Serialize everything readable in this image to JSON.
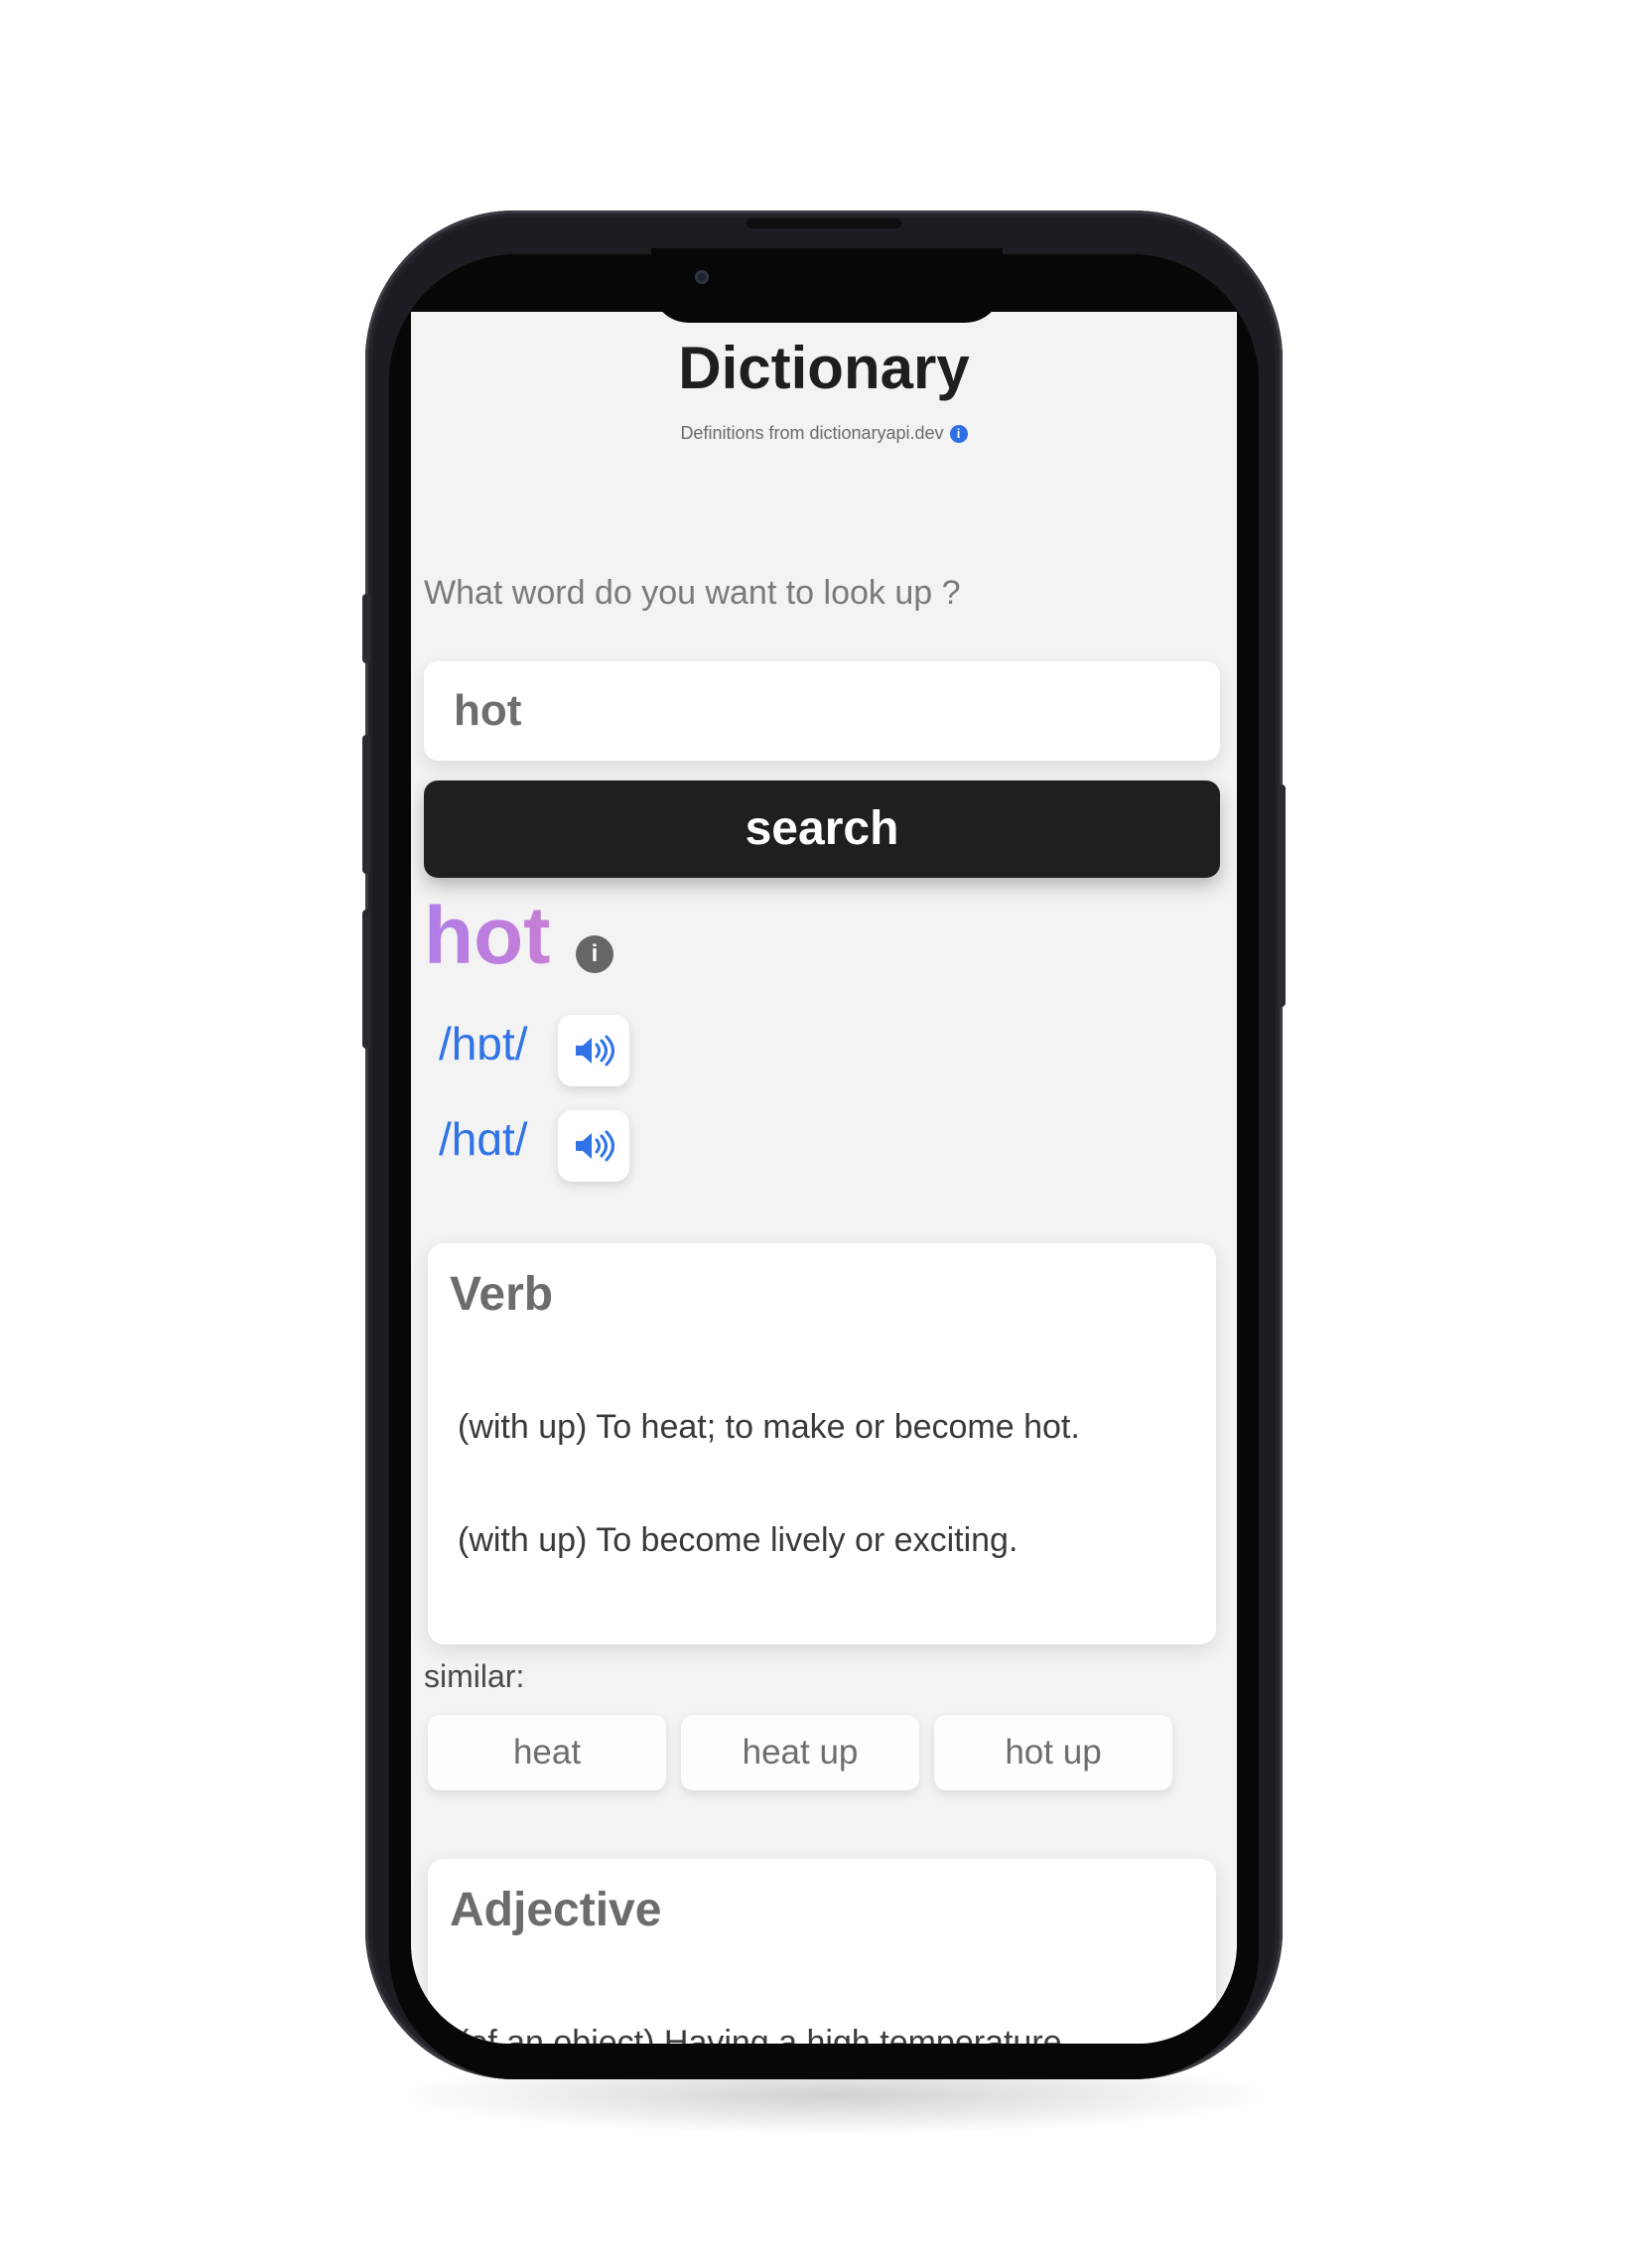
{
  "app": {
    "title": "Dictionary",
    "subtitle": "Definitions from dictionaryapi.dev",
    "subtitle_icon": "info-icon"
  },
  "search": {
    "prompt": "What word do you want to look up ?",
    "value": "hot",
    "button_label": "search"
  },
  "result": {
    "word": "hot",
    "word_icon": "info-icon",
    "phonetics": [
      {
        "text": "/hɒt/",
        "icon": "speaker-icon"
      },
      {
        "text": "/hɑt/",
        "icon": "speaker-icon"
      }
    ]
  },
  "meanings": [
    {
      "part_of_speech": "Verb",
      "definitions": [
        "(with up) To heat; to make or become hot.",
        "(with up) To become lively or exciting."
      ]
    },
    {
      "part_of_speech": "Adjective",
      "definitions": [
        "(of an object) Having a high temperature."
      ]
    }
  ],
  "similar": {
    "label": "similar:",
    "items": [
      "heat",
      "heat up",
      "hot up"
    ]
  },
  "colors": {
    "accent_blue": "#2f73e6",
    "button_dark": "#1f1f21",
    "word_gradient_start": "#b07ee8",
    "word_gradient_end": "#c77ed6",
    "screen_background": "#f3f3f3"
  }
}
